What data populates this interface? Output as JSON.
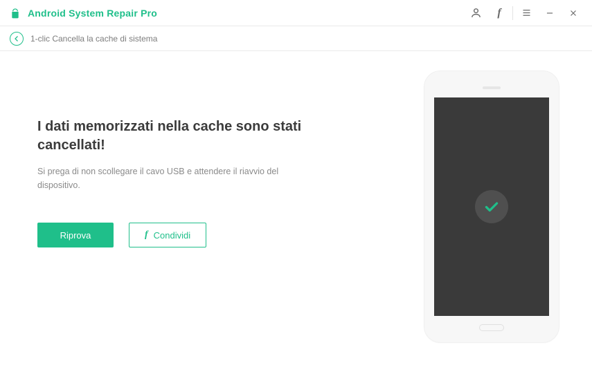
{
  "app": {
    "title": "Android System Repair Pro"
  },
  "breadcrumb": {
    "label": "1-clic Cancella la cache di sistema"
  },
  "main": {
    "headline": "I dati memorizzati nella cache sono stati cancellati!",
    "subtext": "Si prega di non scollegare il cavo USB e attendere il riavvio del dispositivo.",
    "retry_label": "Riprova",
    "share_label": "Condividi"
  },
  "colors": {
    "accent": "#1fbf8a"
  }
}
